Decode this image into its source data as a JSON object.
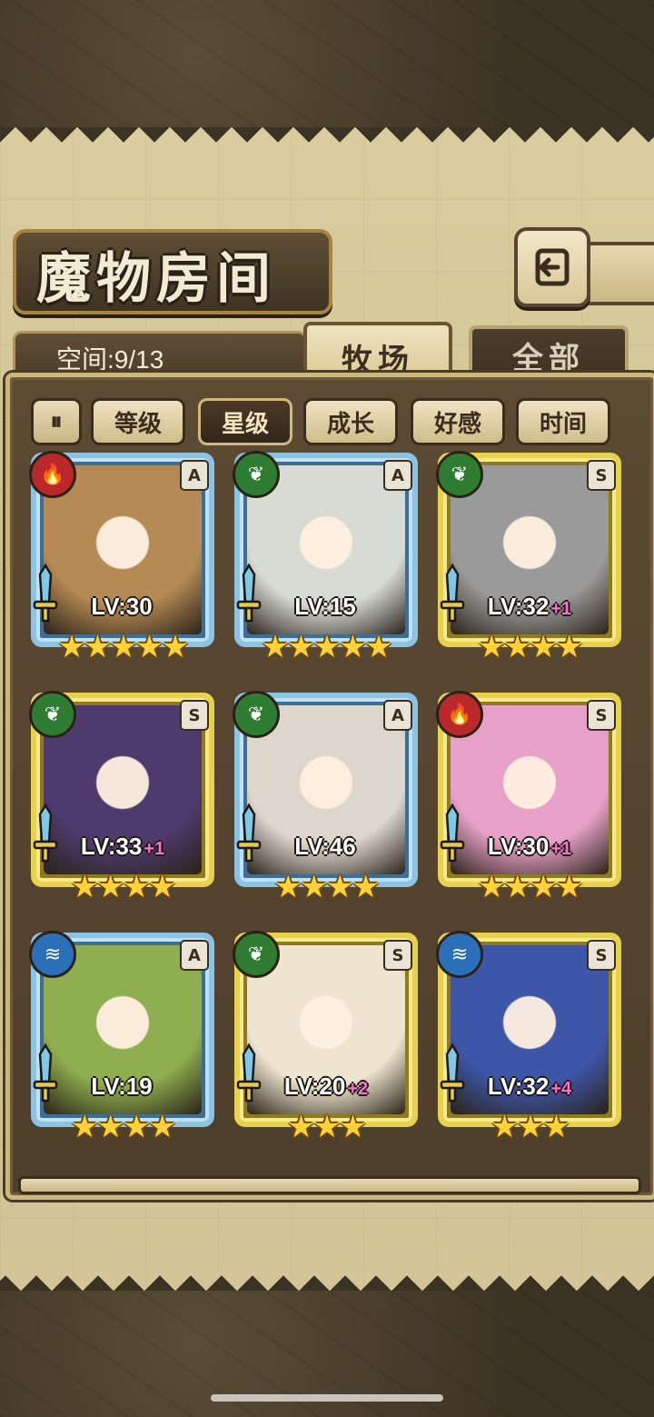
{
  "screen": {
    "title": "魔物房间",
    "space_label": "空间:9/13",
    "tabs": [
      {
        "label": "牧场",
        "active": true
      },
      {
        "label": "全部",
        "active": false
      }
    ],
    "sort_toggle_label": "⏸",
    "sort_buttons": [
      {
        "label": "等级",
        "active": false
      },
      {
        "label": "星级",
        "active": true
      },
      {
        "label": "成长",
        "active": false
      },
      {
        "label": "好感",
        "active": false
      },
      {
        "label": "时间",
        "active": false
      }
    ],
    "back_icon": "back-arrow-icon"
  },
  "colors": {
    "fire": "#b9282a",
    "leaf": "#2e7d32",
    "water": "#2b6fb8",
    "bonus": "#ff6fd1",
    "star": "#ffd23a"
  },
  "monsters": [
    {
      "element": "fire",
      "rank": "A",
      "level": "LV:30",
      "bonus": "",
      "stars": "★★★★★",
      "portrait_color": "#b58a54"
    },
    {
      "element": "leaf",
      "rank": "A",
      "level": "LV:15",
      "bonus": "",
      "stars": "★★★★★",
      "portrait_color": "#d8dbd4"
    },
    {
      "element": "leaf",
      "rank": "S",
      "level": "LV:32",
      "bonus": "+1",
      "stars": "★★★★",
      "portrait_color": "#9a9a9a"
    },
    {
      "element": "leaf",
      "rank": "S",
      "level": "LV:33",
      "bonus": "+1",
      "stars": "★★★★",
      "portrait_color": "#4f3a6e"
    },
    {
      "element": "leaf",
      "rank": "A",
      "level": "LV:46",
      "bonus": "",
      "stars": "★★★★",
      "portrait_color": "#ddd6cc"
    },
    {
      "element": "fire",
      "rank": "S",
      "level": "LV:30",
      "bonus": "+1",
      "stars": "★★★★",
      "portrait_color": "#e7a0c8"
    },
    {
      "element": "water",
      "rank": "A",
      "level": "LV:19",
      "bonus": "",
      "stars": "★★★★",
      "portrait_color": "#8fae4f"
    },
    {
      "element": "leaf",
      "rank": "S",
      "level": "LV:20",
      "bonus": "+2",
      "stars": "★★★",
      "portrait_color": "#efe4cf"
    },
    {
      "element": "water",
      "rank": "S",
      "level": "LV:32",
      "bonus": "+4",
      "stars": "★★★",
      "portrait_color": "#3d56a8"
    }
  ]
}
